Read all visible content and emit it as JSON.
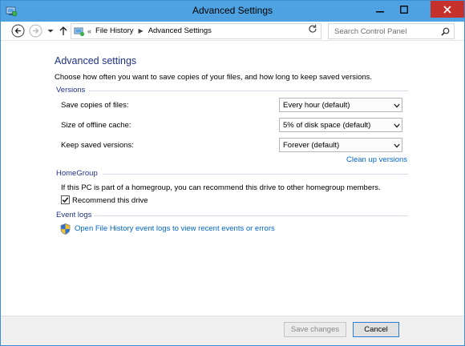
{
  "window": {
    "title": "Advanced Settings"
  },
  "toolbar": {
    "breadcrumb": [
      "File History",
      "Advanced Settings"
    ],
    "search_placeholder": "Search Control Panel"
  },
  "page": {
    "heading": "Advanced settings",
    "intro": "Choose how often you want to save copies of your files, and how long to keep saved versions."
  },
  "versions": {
    "header": "Versions",
    "rows": [
      {
        "label": "Save copies of files:",
        "value": "Every hour (default)"
      },
      {
        "label": "Size of offline cache:",
        "value": "5% of disk space (default)"
      },
      {
        "label": "Keep saved versions:",
        "value": "Forever (default)"
      }
    ],
    "cleanup_link": "Clean up versions"
  },
  "homegroup": {
    "header": "HomeGroup",
    "text": "If this PC is part of a homegroup, you can recommend this drive to other homegroup members.",
    "checkbox_label": "Recommend this drive",
    "checked": true
  },
  "eventlogs": {
    "header": "Event logs",
    "link": "Open File History event logs to view recent events or errors"
  },
  "footer": {
    "save_label": "Save changes",
    "cancel_label": "Cancel"
  },
  "icons": {
    "title": "control-panel-icon",
    "back": "back-arrow-icon",
    "forward": "forward-arrow-icon",
    "recent": "chevron-down-icon",
    "up": "up-arrow-icon",
    "address": "control-panel-icon",
    "refresh": "refresh-icon",
    "search": "search-icon",
    "shield": "shield-icon"
  },
  "colors": {
    "titlebar": "#4ea2e1",
    "close_button": "#c7312b",
    "heading": "#1e3287",
    "link": "#0066cc"
  }
}
